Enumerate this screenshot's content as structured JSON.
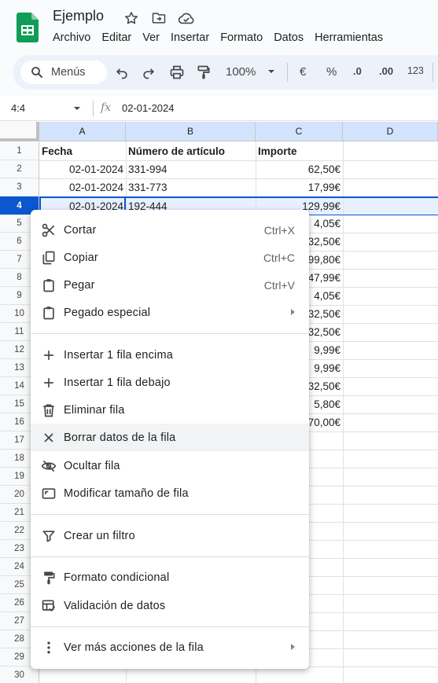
{
  "doc": {
    "title": "Ejemplo"
  },
  "menubar": [
    "Archivo",
    "Editar",
    "Ver",
    "Insertar",
    "Formato",
    "Datos",
    "Herramientas"
  ],
  "toolbar": {
    "menus_label": "Menús",
    "zoom": "100%",
    "currency": "€",
    "percent": "%",
    "decrease_decimals": ".0",
    "increase_decimals": ".00",
    "number_format": "123"
  },
  "formula_bar": {
    "name_box": "4:4",
    "fx": "fx",
    "value": "02-01-2024"
  },
  "grid": {
    "columns": [
      "A",
      "B",
      "C",
      "D"
    ],
    "rows": [
      "1",
      "2",
      "3",
      "4",
      "5",
      "6",
      "7",
      "8",
      "9",
      "10",
      "11",
      "12",
      "13",
      "14",
      "15",
      "16",
      "17",
      "18",
      "19",
      "20",
      "21",
      "22",
      "23",
      "24",
      "25",
      "26",
      "27",
      "28",
      "29",
      "30"
    ],
    "header_row": {
      "fecha": "Fecha",
      "numero": "Número de artículo",
      "importe": "Importe"
    },
    "data": [
      {
        "fecha": "02-01-2024",
        "numero": "331-994",
        "importe": "62,50€"
      },
      {
        "fecha": "02-01-2024",
        "numero": "331-773",
        "importe": "17,99€"
      },
      {
        "fecha": "02-01-2024",
        "numero": "192-444",
        "importe": "129,99€"
      }
    ],
    "partial_importe": [
      "4,05€",
      "32,50€",
      "99,80€",
      "47,99€",
      "4,05€",
      "32,50€",
      "32,50€",
      "9,99€",
      "9,99€",
      "32,50€",
      "5,80€",
      "70,00€"
    ]
  },
  "context_menu": {
    "cut": {
      "label": "Cortar",
      "shortcut": "Ctrl+X"
    },
    "copy": {
      "label": "Copiar",
      "shortcut": "Ctrl+C"
    },
    "paste": {
      "label": "Pegar",
      "shortcut": "Ctrl+V"
    },
    "paste_special": {
      "label": "Pegado especial"
    },
    "insert_above": {
      "label": "Insertar 1 fila encima"
    },
    "insert_below": {
      "label": "Insertar 1 fila debajo"
    },
    "delete_row": {
      "label": "Eliminar fila"
    },
    "clear_row": {
      "label": "Borrar datos de la fila"
    },
    "hide_row": {
      "label": "Ocultar fila"
    },
    "resize_row": {
      "label": "Modificar tamaño de fila"
    },
    "create_filter": {
      "label": "Crear un filtro"
    },
    "conditional_format": {
      "label": "Formato condicional"
    },
    "data_validation": {
      "label": "Validación de datos"
    },
    "more_actions": {
      "label": "Ver más acciones de la fila"
    }
  },
  "colors": {
    "accent": "#0b57d0",
    "selection": "#d3e3fd",
    "sheets_green": "#0f9d58"
  }
}
